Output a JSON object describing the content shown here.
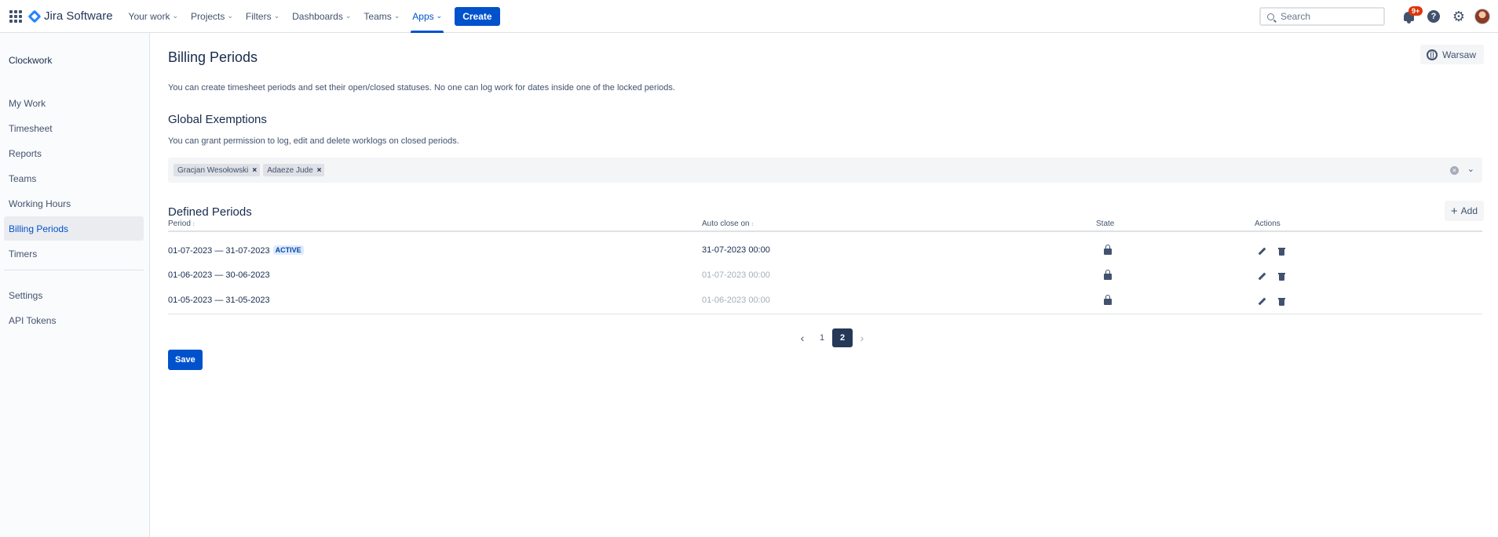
{
  "topnav": {
    "logo_text": "Jira Software",
    "items": [
      {
        "label": "Your work"
      },
      {
        "label": "Projects"
      },
      {
        "label": "Filters"
      },
      {
        "label": "Dashboards"
      },
      {
        "label": "Teams"
      },
      {
        "label": "Apps"
      }
    ],
    "active_item": "Apps",
    "create_label": "Create",
    "search_placeholder": "Search",
    "notification_badge": "9+"
  },
  "sidebar": {
    "title": "Clockwork",
    "items": [
      {
        "label": "My Work"
      },
      {
        "label": "Timesheet"
      },
      {
        "label": "Reports"
      },
      {
        "label": "Teams"
      },
      {
        "label": "Working Hours"
      },
      {
        "label": "Billing Periods"
      },
      {
        "label": "Timers"
      },
      {
        "label": "Settings"
      },
      {
        "label": "API Tokens"
      }
    ],
    "active_item": "Billing Periods"
  },
  "main": {
    "title": "Billing Periods",
    "timezone_label": "Warsaw",
    "description": "You can create timesheet periods and set their open/closed statuses. No one can log work for dates inside one of the locked periods.",
    "exemptions": {
      "title": "Global Exemptions",
      "description": "You can grant permission to log, edit and delete worklogs on closed periods.",
      "tags": [
        "Gracjan Wesołowski",
        "Adaeze Jude"
      ]
    },
    "periods": {
      "title": "Defined Periods",
      "add_label": "Add",
      "columns": {
        "period": "Period",
        "auto_close": "Auto close on",
        "state": "State",
        "actions": "Actions"
      },
      "rows": [
        {
          "period": "01-07-2023 — 31-07-2023",
          "badge": "ACTIVE",
          "auto_close": "31-07-2023 00:00",
          "state": "locked"
        },
        {
          "period": "01-06-2023 — 30-06-2023",
          "badge": "",
          "auto_close": "01-07-2023 00:00",
          "state": "locked"
        },
        {
          "period": "01-05-2023 — 31-05-2023",
          "badge": "",
          "auto_close": "01-06-2023 00:00",
          "state": "locked"
        }
      ]
    },
    "pagination": {
      "pages": [
        "1",
        "2"
      ],
      "current": "2"
    },
    "save_label": "Save"
  },
  "colors": {
    "accent": "#0052cc",
    "text": "#172b4d",
    "subtle": "#42526e",
    "badge": "#de350b"
  },
  "icons": [
    "app-switcher-icon",
    "jira-logo-icon",
    "chevron-down-icon",
    "search-icon",
    "bell-icon",
    "help-icon",
    "gear-icon",
    "globe-icon",
    "close-icon",
    "clear-icon",
    "plus-icon",
    "sort-icon",
    "lock-icon",
    "pencil-icon",
    "trash-icon",
    "chevron-left-icon",
    "chevron-right-icon"
  ]
}
